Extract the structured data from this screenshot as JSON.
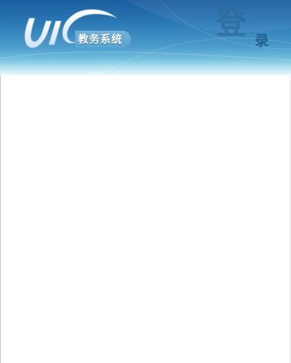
{
  "header": {
    "logo_text": "UIC",
    "system_name": "教务系统",
    "title_char_1": "登",
    "title_char_2": "录"
  },
  "colors": {
    "header_top": "#1a5d9e",
    "header_mid": "#4b9ccc",
    "header_bottom": "#eef9fd",
    "title_text": "#2f6a9c"
  },
  "icons": {
    "logo": "uic-swoosh-logo"
  }
}
